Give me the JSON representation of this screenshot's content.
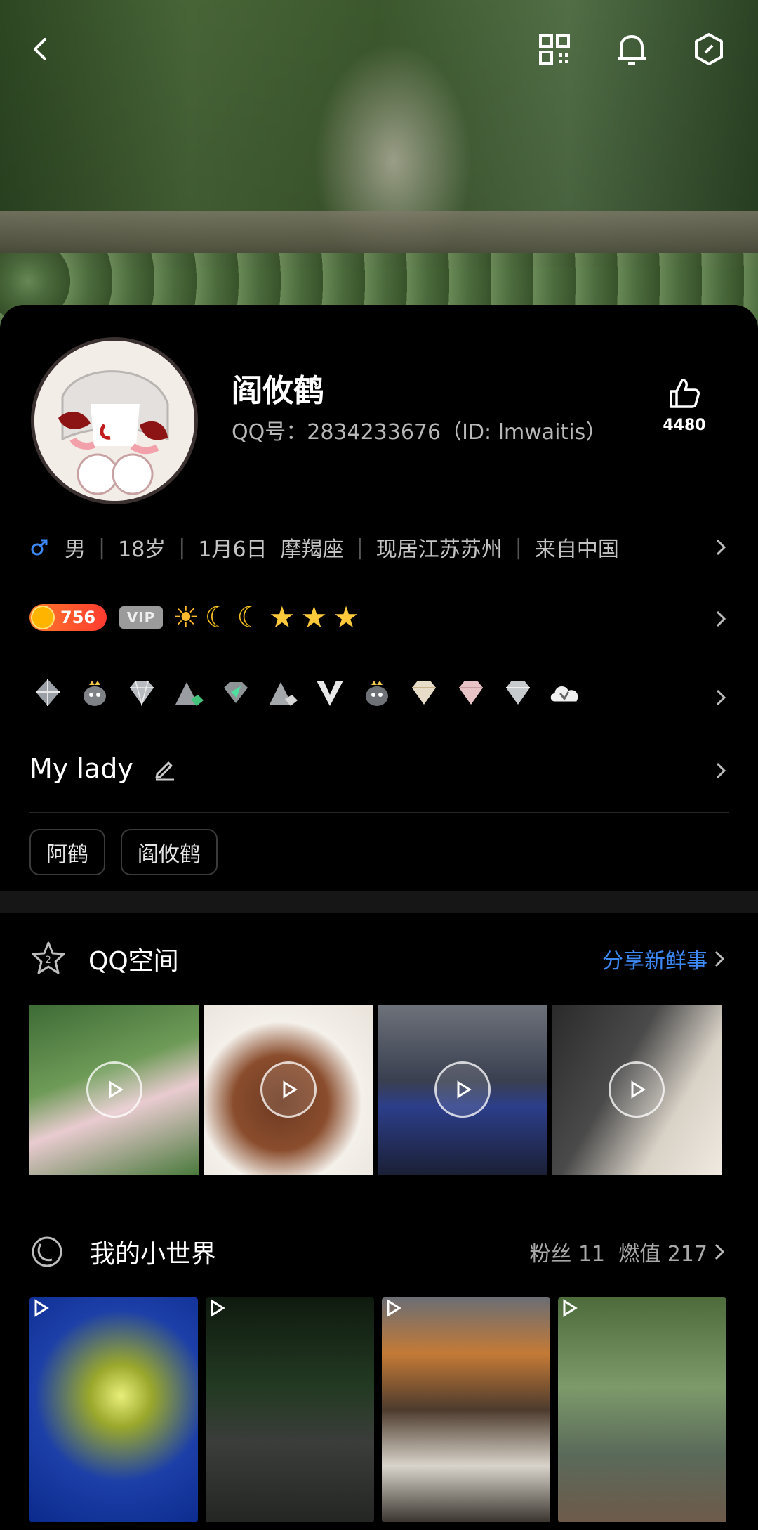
{
  "profile": {
    "name": "阎攸鹤",
    "qq_id": "QQ号：2834233676（ID: lmwaitis）",
    "likes": "4480",
    "gender_icon": "male-icon",
    "info": [
      "男",
      "18岁",
      "1月6日  摩羯座",
      "现居江苏苏州",
      "来自中国"
    ],
    "level": "756",
    "vip": "VIP",
    "signature": "My lady",
    "tags": [
      "阿鹤",
      "阎攸鹤"
    ]
  },
  "qzone": {
    "title": "QQ空间",
    "action": "分享新鲜事"
  },
  "world": {
    "title": "我的小世界",
    "stats": "粉丝 11  燃值 217"
  },
  "colors": {
    "accent": "#3d8af7",
    "level_badge": "#ff5a2a",
    "gender": "#3d8af7"
  }
}
